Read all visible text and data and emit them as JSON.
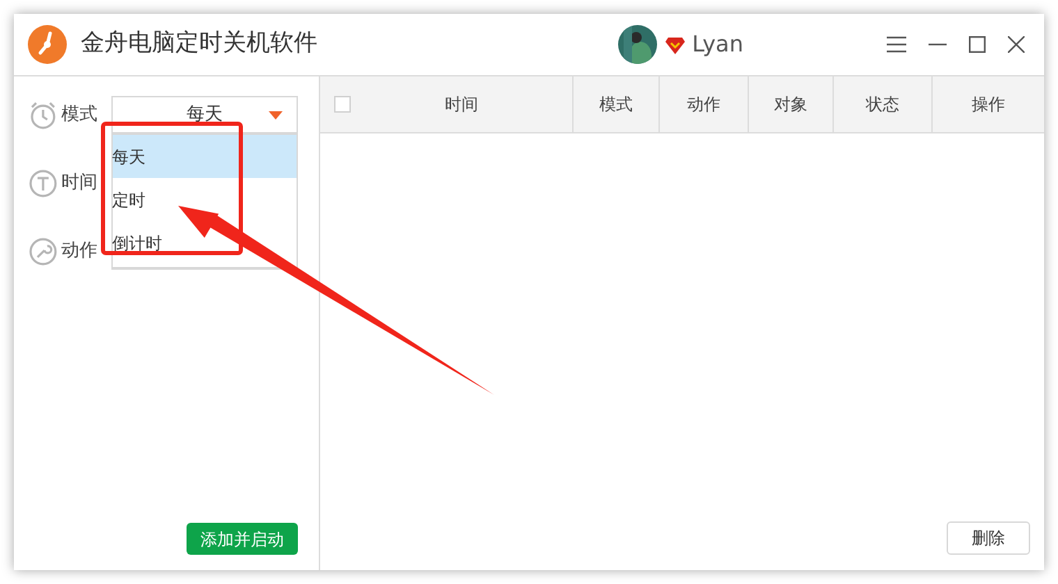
{
  "window": {
    "title": "金舟电脑定时关机软件",
    "user": "Lyan"
  },
  "form": {
    "fields": [
      {
        "label": "模式",
        "kind": "select",
        "value": "每天"
      },
      {
        "label": "时间",
        "kind": "time"
      },
      {
        "label": "动作",
        "kind": "select"
      }
    ],
    "dropdown": {
      "options": [
        {
          "label": "每天",
          "selected": true
        },
        {
          "label": "定时",
          "selected": false
        },
        {
          "label": "倒计时",
          "selected": false
        }
      ]
    },
    "add_button": "添加并启动"
  },
  "table": {
    "select_all": {
      "checked": false
    },
    "columns": [
      "时间",
      "模式",
      "动作",
      "对象",
      "状态",
      "操作"
    ]
  },
  "delete_button": "删除"
}
